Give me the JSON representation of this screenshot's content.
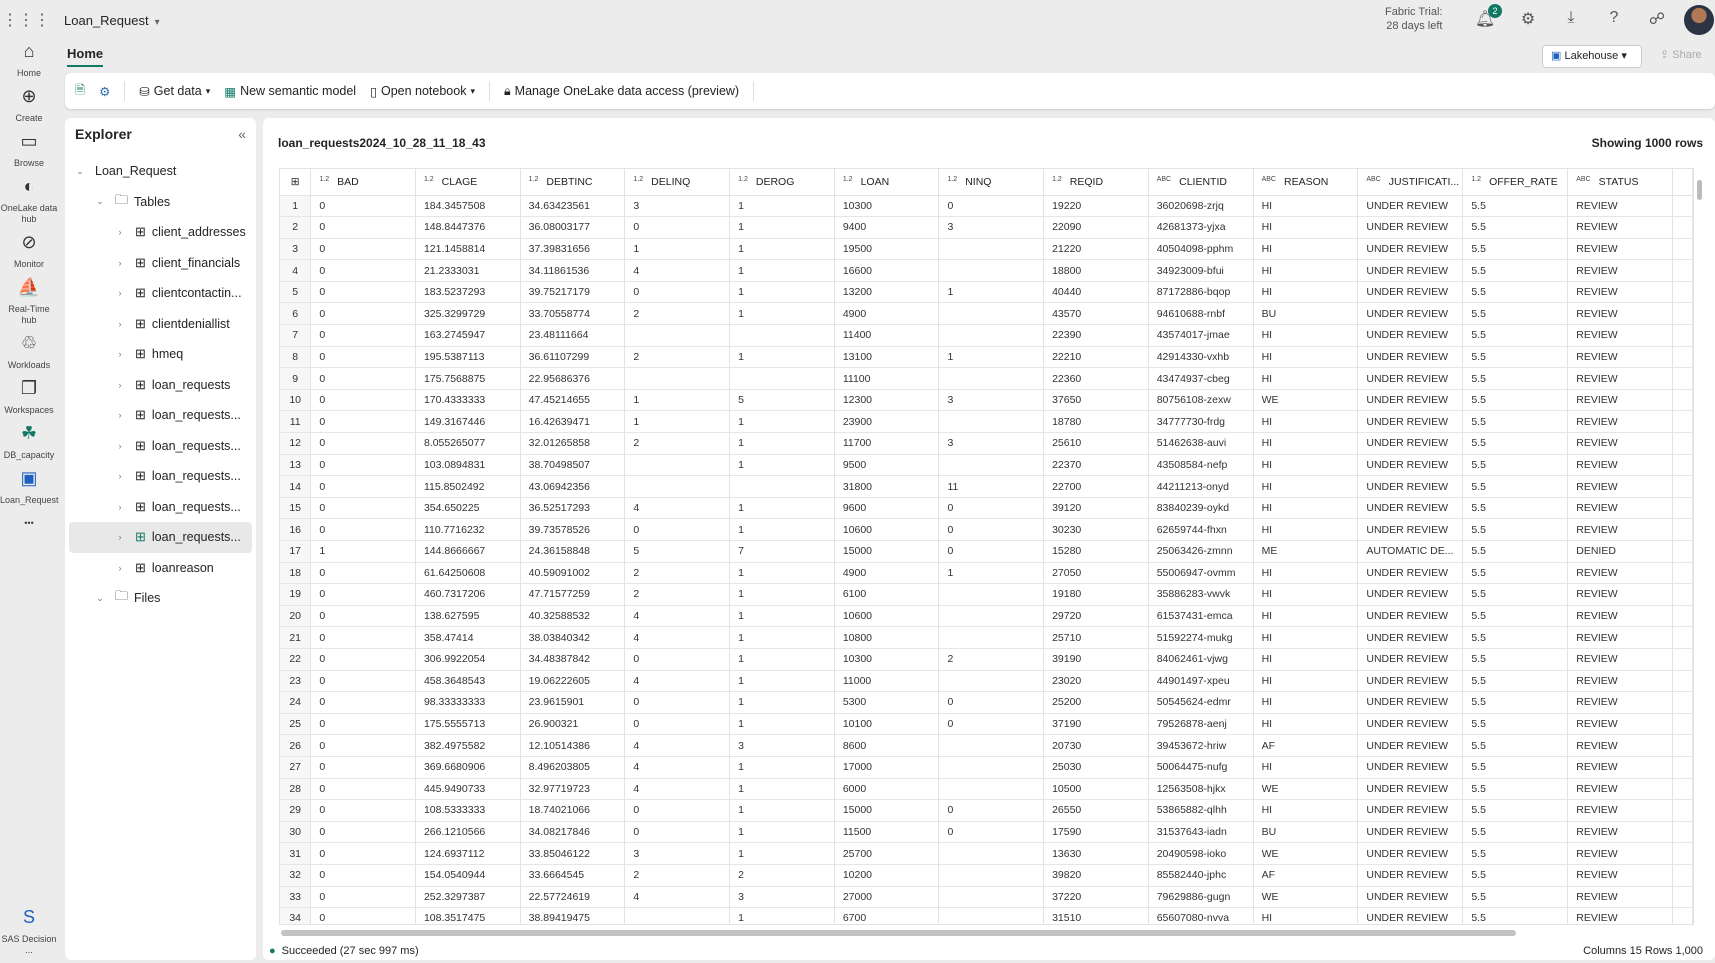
{
  "topbar": {
    "app_name": "Loan_Request",
    "trial_line1": "Fabric Trial:",
    "trial_line2": "28 days left",
    "notif_count": "2"
  },
  "rail": [
    {
      "label": "Home",
      "icon": "⌂"
    },
    {
      "label": "Create",
      "icon": "⊕"
    },
    {
      "label": "Browse",
      "icon": "▭"
    },
    {
      "label": "OneLake data hub",
      "icon": "◐"
    },
    {
      "label": "Monitor",
      "icon": "⊘"
    },
    {
      "label": "Real-Time hub",
      "icon": "⛵"
    },
    {
      "label": "Workloads",
      "icon": "♲"
    },
    {
      "label": "Workspaces",
      "icon": "❐"
    },
    {
      "label": "DB_capacity",
      "icon": "☘"
    },
    {
      "label": "Loan_Request",
      "icon": "▣"
    }
  ],
  "rail_bottom": {
    "label": "SAS Decision ..."
  },
  "home_tab": "Home",
  "lakehouse_label": "Lakehouse",
  "share_label": "Share",
  "toolbar": {
    "get_data": "Get data",
    "semantic": "New semantic model",
    "notebook": "Open notebook",
    "onelake": "Manage OneLake data access (preview)"
  },
  "explorer": {
    "title": "Explorer",
    "root": "Loan_Request",
    "tables_label": "Tables",
    "files_label": "Files",
    "tables": [
      "client_addresses",
      "client_financials",
      "clientcontactin...",
      "clientdeniallist",
      "hmeq",
      "loan_requests",
      "loan_requests...",
      "loan_requests...",
      "loan_requests...",
      "loan_requests...",
      "loan_requests...",
      "loanreason"
    ],
    "selected_index": 10
  },
  "table": {
    "title": "loan_requests2024_10_28_11_18_43",
    "showing": "Showing 1000 rows",
    "columns": [
      {
        "type": "1.2",
        "name": "BAD"
      },
      {
        "type": "1.2",
        "name": "CLAGE"
      },
      {
        "type": "1.2",
        "name": "DEBTINC"
      },
      {
        "type": "1.2",
        "name": "DELINQ"
      },
      {
        "type": "1.2",
        "name": "DEROG"
      },
      {
        "type": "1.2",
        "name": "LOAN"
      },
      {
        "type": "1.2",
        "name": "NINQ"
      },
      {
        "type": "1.2",
        "name": "REQID"
      },
      {
        "type": "ABC",
        "name": "CLIENTID"
      },
      {
        "type": "ABC",
        "name": "REASON"
      },
      {
        "type": "ABC",
        "name": "JUSTIFICATI..."
      },
      {
        "type": "1.2",
        "name": "OFFER_RATE"
      },
      {
        "type": "ABC",
        "name": "STATUS"
      }
    ],
    "rows": [
      [
        "0",
        "184.3457508",
        "34.63423561",
        "3",
        "1",
        "10300",
        "0",
        "19220",
        "36020698-zrjq",
        "HI",
        "UNDER REVIEW",
        "5.5",
        "REVIEW"
      ],
      [
        "0",
        "148.8447376",
        "36.08003177",
        "0",
        "1",
        "9400",
        "3",
        "22090",
        "42681373-yjxa",
        "HI",
        "UNDER REVIEW",
        "5.5",
        "REVIEW"
      ],
      [
        "0",
        "121.1458814",
        "37.39831656",
        "1",
        "1",
        "19500",
        "",
        "21220",
        "40504098-pphm",
        "HI",
        "UNDER REVIEW",
        "5.5",
        "REVIEW"
      ],
      [
        "0",
        "21.2333031",
        "34.11861536",
        "4",
        "1",
        "16600",
        "",
        "18800",
        "34923009-bfui",
        "HI",
        "UNDER REVIEW",
        "5.5",
        "REVIEW"
      ],
      [
        "0",
        "183.5237293",
        "39.75217179",
        "0",
        "1",
        "13200",
        "1",
        "40440",
        "87172886-bqop",
        "HI",
        "UNDER REVIEW",
        "5.5",
        "REVIEW"
      ],
      [
        "0",
        "325.3299729",
        "33.70558774",
        "2",
        "1",
        "4900",
        "",
        "43570",
        "94610688-rnbf",
        "BU",
        "UNDER REVIEW",
        "5.5",
        "REVIEW"
      ],
      [
        "0",
        "163.2745947",
        "23.48111664",
        "",
        "",
        "11400",
        "",
        "22390",
        "43574017-jmae",
        "HI",
        "UNDER REVIEW",
        "5.5",
        "REVIEW"
      ],
      [
        "0",
        "195.5387113",
        "36.61107299",
        "2",
        "1",
        "13100",
        "1",
        "22210",
        "42914330-vxhb",
        "HI",
        "UNDER REVIEW",
        "5.5",
        "REVIEW"
      ],
      [
        "0",
        "175.7568875",
        "22.95686376",
        "",
        "",
        "11100",
        "",
        "22360",
        "43474937-cbeg",
        "HI",
        "UNDER REVIEW",
        "5.5",
        "REVIEW"
      ],
      [
        "0",
        "170.4333333",
        "47.45214655",
        "1",
        "5",
        "12300",
        "3",
        "37650",
        "80756108-zexw",
        "WE",
        "UNDER REVIEW",
        "5.5",
        "REVIEW"
      ],
      [
        "0",
        "149.3167446",
        "16.42639471",
        "1",
        "1",
        "23900",
        "",
        "18780",
        "34777730-frdg",
        "HI",
        "UNDER REVIEW",
        "5.5",
        "REVIEW"
      ],
      [
        "0",
        "8.055265077",
        "32.01265858",
        "2",
        "1",
        "11700",
        "3",
        "25610",
        "51462638-auvi",
        "HI",
        "UNDER REVIEW",
        "5.5",
        "REVIEW"
      ],
      [
        "0",
        "103.0894831",
        "38.70498507",
        "",
        "1",
        "9500",
        "",
        "22370",
        "43508584-nefp",
        "HI",
        "UNDER REVIEW",
        "5.5",
        "REVIEW"
      ],
      [
        "0",
        "115.8502492",
        "43.06942356",
        "",
        "",
        "31800",
        "11",
        "22700",
        "44211213-onyd",
        "HI",
        "UNDER REVIEW",
        "5.5",
        "REVIEW"
      ],
      [
        "0",
        "354.650225",
        "36.52517293",
        "4",
        "1",
        "9600",
        "0",
        "39120",
        "83840239-oykd",
        "HI",
        "UNDER REVIEW",
        "5.5",
        "REVIEW"
      ],
      [
        "0",
        "110.7716232",
        "39.73578526",
        "0",
        "1",
        "10600",
        "0",
        "30230",
        "62659744-fhxn",
        "HI",
        "UNDER REVIEW",
        "5.5",
        "REVIEW"
      ],
      [
        "1",
        "144.8666667",
        "24.36158848",
        "5",
        "7",
        "15000",
        "0",
        "15280",
        "25063426-zmnn",
        "ME",
        "AUTOMATIC DE...",
        "5.5",
        "DENIED"
      ],
      [
        "0",
        "61.64250608",
        "40.59091002",
        "2",
        "1",
        "4900",
        "1",
        "27050",
        "55006947-ovmm",
        "HI",
        "UNDER REVIEW",
        "5.5",
        "REVIEW"
      ],
      [
        "0",
        "460.7317206",
        "47.71577259",
        "2",
        "1",
        "6100",
        "",
        "19180",
        "35886283-vwvk",
        "HI",
        "UNDER REVIEW",
        "5.5",
        "REVIEW"
      ],
      [
        "0",
        "138.627595",
        "40.32588532",
        "4",
        "1",
        "10600",
        "",
        "29720",
        "61537431-emca",
        "HI",
        "UNDER REVIEW",
        "5.5",
        "REVIEW"
      ],
      [
        "0",
        "358.47414",
        "38.03840342",
        "4",
        "1",
        "10800",
        "",
        "25710",
        "51592274-mukg",
        "HI",
        "UNDER REVIEW",
        "5.5",
        "REVIEW"
      ],
      [
        "0",
        "306.9922054",
        "34.48387842",
        "0",
        "1",
        "10300",
        "2",
        "39190",
        "84062461-vjwg",
        "HI",
        "UNDER REVIEW",
        "5.5",
        "REVIEW"
      ],
      [
        "0",
        "458.3648543",
        "19.06222605",
        "4",
        "1",
        "11000",
        "",
        "23020",
        "44901497-xpeu",
        "HI",
        "UNDER REVIEW",
        "5.5",
        "REVIEW"
      ],
      [
        "0",
        "98.33333333",
        "23.9615901",
        "0",
        "1",
        "5300",
        "0",
        "25200",
        "50545624-edmr",
        "HI",
        "UNDER REVIEW",
        "5.5",
        "REVIEW"
      ],
      [
        "0",
        "175.5555713",
        "26.900321",
        "0",
        "1",
        "10100",
        "0",
        "37190",
        "79526878-aenj",
        "HI",
        "UNDER REVIEW",
        "5.5",
        "REVIEW"
      ],
      [
        "0",
        "382.4975582",
        "12.10514386",
        "4",
        "3",
        "8600",
        "",
        "20730",
        "39453672-hriw",
        "AF",
        "UNDER REVIEW",
        "5.5",
        "REVIEW"
      ],
      [
        "0",
        "369.6680906",
        "8.496203805",
        "4",
        "1",
        "17000",
        "",
        "25030",
        "50064475-nufg",
        "HI",
        "UNDER REVIEW",
        "5.5",
        "REVIEW"
      ],
      [
        "0",
        "445.9490733",
        "32.97719723",
        "4",
        "1",
        "6000",
        "",
        "10500",
        "12563508-hjkx",
        "WE",
        "UNDER REVIEW",
        "5.5",
        "REVIEW"
      ],
      [
        "0",
        "108.5333333",
        "18.74021066",
        "0",
        "1",
        "15000",
        "0",
        "26550",
        "53865882-qlhh",
        "HI",
        "UNDER REVIEW",
        "5.5",
        "REVIEW"
      ],
      [
        "0",
        "266.1210566",
        "34.08217846",
        "0",
        "1",
        "11500",
        "0",
        "17590",
        "31537643-iadn",
        "BU",
        "UNDER REVIEW",
        "5.5",
        "REVIEW"
      ],
      [
        "0",
        "124.6937112",
        "33.85046122",
        "3",
        "1",
        "25700",
        "",
        "13630",
        "20490598-ioko",
        "WE",
        "UNDER REVIEW",
        "5.5",
        "REVIEW"
      ],
      [
        "0",
        "154.0540944",
        "33.6664545",
        "2",
        "2",
        "10200",
        "",
        "39820",
        "85582440-jphc",
        "AF",
        "UNDER REVIEW",
        "5.5",
        "REVIEW"
      ],
      [
        "0",
        "252.3297387",
        "22.57724619",
        "4",
        "3",
        "27000",
        "",
        "37220",
        "79629886-gugn",
        "WE",
        "UNDER REVIEW",
        "5.5",
        "REVIEW"
      ],
      [
        "0",
        "108.3517475",
        "38.89419475",
        "",
        "1",
        "6700",
        "",
        "31510",
        "65607080-nvva",
        "HI",
        "UNDER REVIEW",
        "5.5",
        "REVIEW"
      ]
    ]
  },
  "status": {
    "message": "Succeeded (27 sec 997 ms)",
    "summary": "Columns 15 Rows 1,000"
  }
}
